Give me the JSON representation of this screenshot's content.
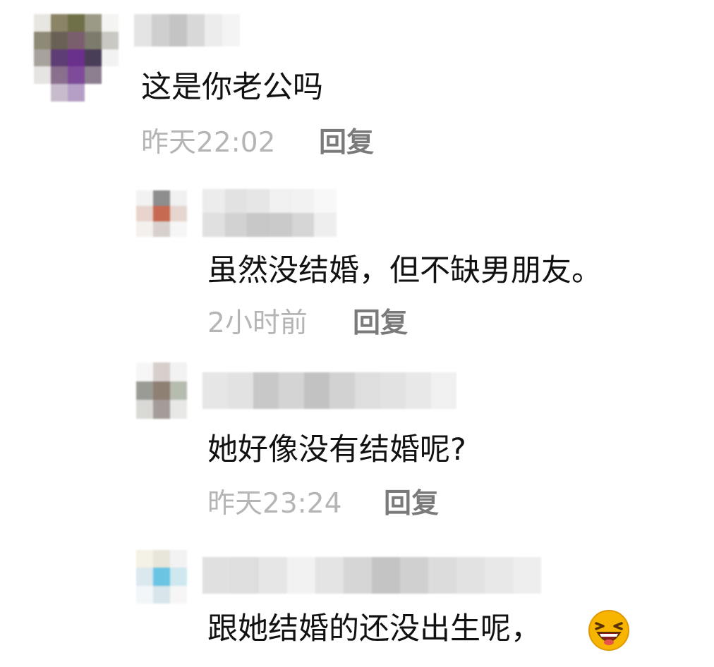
{
  "comments": [
    {
      "text": "这是你老公吗",
      "time": "昨天22:02",
      "reply": "回复"
    },
    {
      "text": "虽然没结婚，但不缺男朋友。",
      "time": "2小时前",
      "reply": "回复"
    },
    {
      "text": "她好像没有结婚呢?",
      "time": "昨天23:24",
      "reply": "回复"
    },
    {
      "text": "跟她结婚的还没出生呢，",
      "emoji": "laughing-face-icon"
    }
  ],
  "colors": {
    "text": "#111111",
    "time": "#b5b5b5",
    "reply": "#7a7a7a",
    "emoji_face": "#f7b500"
  }
}
